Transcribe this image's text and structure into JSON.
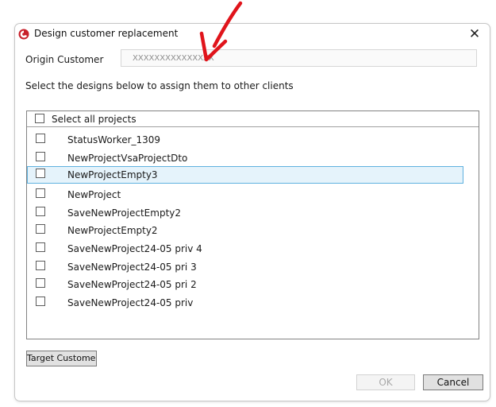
{
  "window": {
    "title": "Design customer replacement",
    "close_glyph": "✕"
  },
  "origin": {
    "label": "Origin Customer",
    "value": "XXXXXXXXXXXXXXX"
  },
  "instructions": "Select the designs below to assign them to other clients",
  "list": {
    "select_all_label": "Select all projects",
    "items": [
      {
        "label": "StatusWorker_1309"
      },
      {
        "label": "NewProjectVsaProjectDto"
      },
      {
        "label": "NewProjectEmpty3",
        "selected": true
      },
      {
        "label": "NewProject"
      },
      {
        "label": "SaveNewProjectEmpty2"
      },
      {
        "label": "NewProjectEmpty2"
      },
      {
        "label": "SaveNewProject24-05 priv 4"
      },
      {
        "label": "SaveNewProject24-05 pri 3"
      },
      {
        "label": "SaveNewProject24-05 pri 2"
      },
      {
        "label": "SaveNewProject24-05 priv"
      }
    ]
  },
  "buttons": {
    "target_customer": "Target Customer",
    "ok": "OK",
    "cancel": "Cancel"
  },
  "colors": {
    "arrow": "#e0141b",
    "selection_fill": "#e5f3fb",
    "selection_border": "#5fb1df",
    "app_icon": "#c8202a"
  },
  "icons": {
    "app": "app-logo-icon",
    "close": "close-icon",
    "annotation": "red-arrow-icon"
  }
}
